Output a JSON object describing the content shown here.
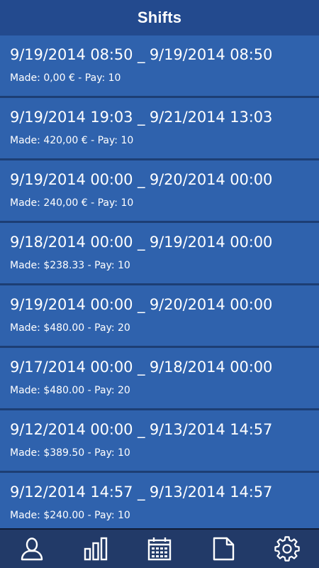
{
  "header": {
    "title": "Shifts"
  },
  "shifts": [
    {
      "range": "9/19/2014 08:50 _ 9/19/2014 08:50",
      "made": "Made: 0,00 € - Pay: 10"
    },
    {
      "range": "9/19/2014 19:03 _ 9/21/2014 13:03",
      "made": "Made: 420,00 € - Pay: 10"
    },
    {
      "range": "9/19/2014 00:00 _ 9/20/2014 00:00",
      "made": "Made: 240,00 € - Pay: 10"
    },
    {
      "range": "9/18/2014 00:00 _ 9/19/2014 00:00",
      "made": "Made: $238.33 - Pay: 10"
    },
    {
      "range": "9/19/2014 00:00 _ 9/20/2014 00:00",
      "made": "Made: $480.00 - Pay: 20"
    },
    {
      "range": "9/17/2014 00:00 _ 9/18/2014 00:00",
      "made": "Made: $480.00 - Pay: 20"
    },
    {
      "range": "9/12/2014 00:00 _ 9/13/2014 14:57",
      "made": "Made: $389.50 - Pay: 10"
    },
    {
      "range": "9/12/2014 14:57 _ 9/13/2014 14:57",
      "made": "Made: $240.00 - Pay: 10"
    }
  ],
  "tabbar": {
    "tabs": [
      {
        "icon": "user-icon"
      },
      {
        "icon": "bar-chart-icon"
      },
      {
        "icon": "calendar-icon"
      },
      {
        "icon": "document-icon"
      },
      {
        "icon": "gear-icon"
      }
    ]
  },
  "colors": {
    "header_bg": "#234a8e",
    "row_bg": "#2f62ad",
    "row_divider": "#1d3e74",
    "tabbar_bg": "#223a68",
    "text": "#ffffff"
  }
}
